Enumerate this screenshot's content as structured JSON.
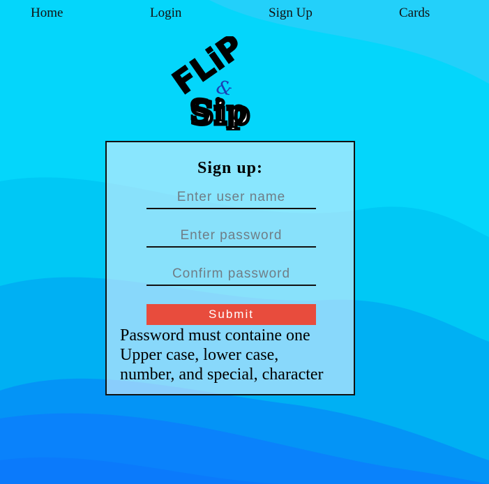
{
  "nav": {
    "home": "Home",
    "login": "Login",
    "signup": "Sign Up",
    "cards": "Cards"
  },
  "logo": {
    "line1": "FLiP",
    "amp": "&",
    "line2": "Sip"
  },
  "form": {
    "title": "Sign up:",
    "username_placeholder": "Enter user name",
    "password_placeholder": "Enter password",
    "confirm_placeholder": "Confirm password",
    "submit_label": "Submit",
    "hint_line1": "Password must containe one",
    "hint_line2": "Upper case, lower case,",
    "hint_line3": "number, and special, character"
  },
  "colors": {
    "background_top": "#0ad4f6",
    "background_bottom": "#0a7cfb",
    "submit_bg": "#e84c3d",
    "card_bg": "#c8ecfb"
  }
}
